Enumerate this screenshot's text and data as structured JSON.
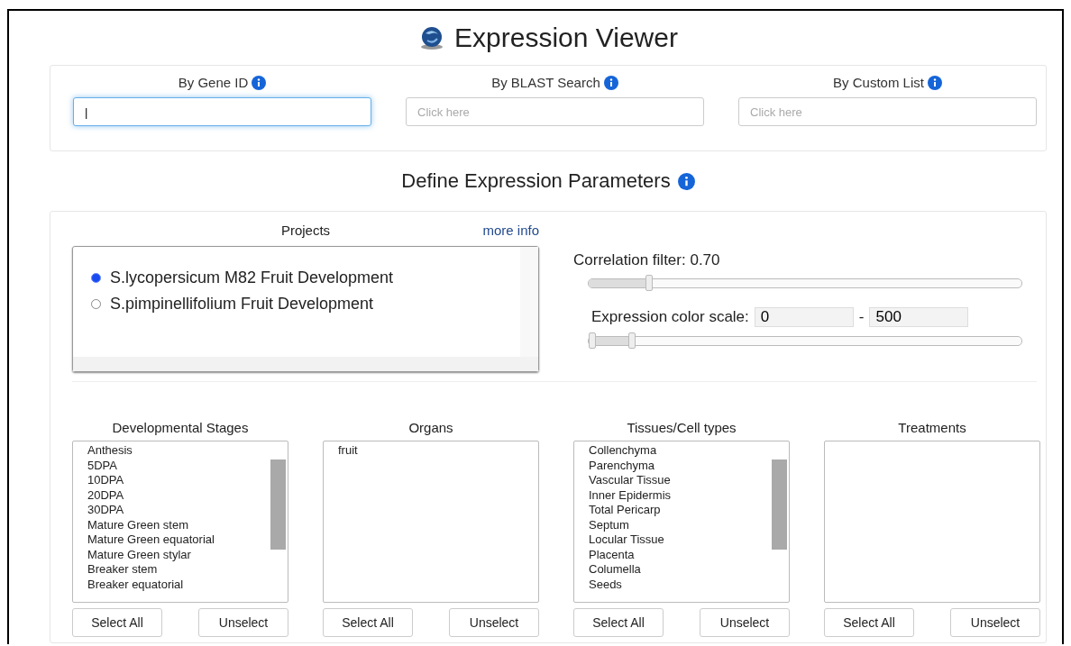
{
  "title": "Expression Viewer",
  "search": [
    {
      "label": "By Gene ID",
      "value": "|",
      "focused": true
    },
    {
      "label": "By BLAST Search",
      "placeholder": "Click here",
      "focused": false
    },
    {
      "label": "By Custom List",
      "placeholder": "Click here",
      "focused": false
    }
  ],
  "params_heading": "Define Expression Parameters",
  "projects": {
    "label": "Projects",
    "link": "more info",
    "items": [
      {
        "name": "S.lycopersicum M82 Fruit Development",
        "selected": true
      },
      {
        "name": "S.pimpinellifolium Fruit Development",
        "selected": false
      }
    ]
  },
  "correlation": {
    "label": "Correlation filter: 0.70",
    "level": 0.14
  },
  "color_scale": {
    "label": "Expression color scale:",
    "min": "0",
    "separator": "-",
    "max": "500",
    "level": 0.1
  },
  "lists": [
    {
      "label": "Developmental Stages",
      "scrollbar": true,
      "items": [
        "Anthesis",
        "5DPA",
        "10DPA",
        "20DPA",
        "30DPA",
        "Mature Green stem",
        "Mature Green equatorial",
        "Mature Green stylar",
        "Breaker stem",
        "Breaker equatorial"
      ],
      "buttons": [
        "Select All",
        "Unselect"
      ]
    },
    {
      "label": "Organs",
      "scrollbar": false,
      "items": [
        "fruit"
      ],
      "buttons": [
        "Select All",
        "Unselect"
      ]
    },
    {
      "label": "Tissues/Cell types",
      "scrollbar": true,
      "items": [
        "Collenchyma",
        "Parenchyma",
        "Vascular Tissue",
        "Inner Epidermis",
        "Total Pericarp",
        "Septum",
        "Locular Tissue",
        "Placenta",
        "Columella",
        "Seeds"
      ],
      "buttons": [
        "Select All",
        "Unselect"
      ]
    },
    {
      "label": "Treatments",
      "scrollbar": false,
      "buttons": [
        "Select All",
        "Unselect"
      ]
    }
  ]
}
